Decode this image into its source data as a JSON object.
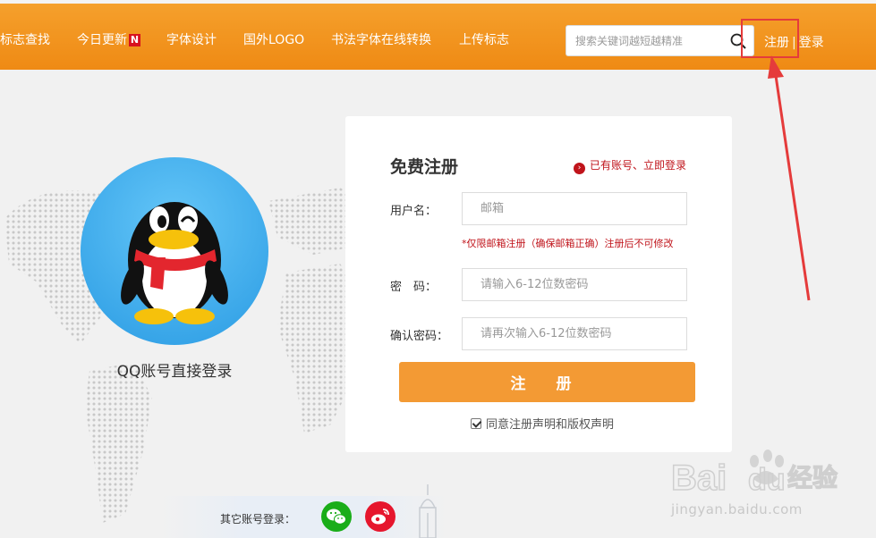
{
  "header": {
    "nav": [
      {
        "label": "标志查找"
      },
      {
        "label": "今日更新",
        "badge": "N"
      },
      {
        "label": "字体设计"
      },
      {
        "label": "国外LOGO"
      },
      {
        "label": "书法字体在线转换"
      },
      {
        "label": "上传标志"
      }
    ],
    "search": {
      "placeholder": "搜索关键词越短越精准",
      "icon": "search-icon"
    },
    "register_label": "注册",
    "separator": "|",
    "login_label": "登录"
  },
  "qq": {
    "label": "QQ账号直接登录",
    "icon": "qq-penguin-icon"
  },
  "form": {
    "title": "免费注册",
    "login_link": "已有账号、立即登录",
    "username": {
      "label": "用户名：",
      "placeholder": "邮箱"
    },
    "hint": "*仅限邮箱注册（确保邮箱正确）注册后不可修改",
    "password": {
      "label": "密　码：",
      "placeholder": "请输入6-12位数密码"
    },
    "confirm": {
      "label": "确认密码：",
      "placeholder": "请再次输入6-12位数密码"
    },
    "submit_label": "注 册",
    "agree": {
      "checked": true,
      "text": "同意注册声明和版权声明"
    }
  },
  "social": {
    "label": "其它账号登录：",
    "icons": [
      "wechat-icon",
      "weibo-icon"
    ]
  },
  "watermark": {
    "logo": "Bai du 经验",
    "url": "jingyan.baidu.com"
  },
  "colors": {
    "header": "#ef8a14",
    "accent_button": "#f39a34",
    "link_red": "#c0141b",
    "wechat": "#1aad19",
    "weibo": "#e6162d",
    "annotation": "#e53b3b"
  }
}
